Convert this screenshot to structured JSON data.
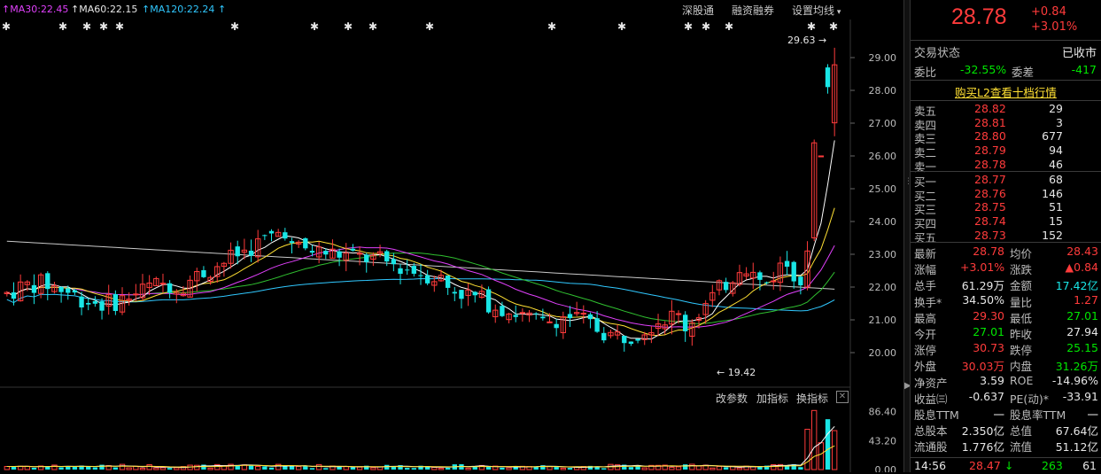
{
  "ma_legend": [
    {
      "label": "MA30:22.45",
      "color": "#e040fb"
    },
    {
      "label": "MA60:22.15",
      "color": "#e6e6e6"
    },
    {
      "label": "MA120:22.24",
      "color": "#30c8ff"
    }
  ],
  "toolbar": {
    "shen_gu_tong": "深股通",
    "rong_zi_rong_quan": "融资融券",
    "set_ma": "设置均线"
  },
  "vol_toolbar": {
    "change_params": "改参数",
    "add_indicator": "加指标",
    "swap_indicator": "换指标"
  },
  "annotations": {
    "high_label": "29.63",
    "low_label": "19.42"
  },
  "chart_data": {
    "type": "candlestick",
    "price_axis_ticks": [
      "29.00",
      "28.00",
      "27.00",
      "26.00",
      "25.00",
      "24.00",
      "23.00",
      "22.00",
      "21.00",
      "20.00"
    ],
    "volume_axis_ticks": [
      "86.40",
      "43.20",
      "0.00"
    ],
    "ylim": [
      19.0,
      30.0
    ],
    "volume_ylim": [
      0,
      95
    ],
    "last_candles": [
      {
        "open": 22.0,
        "close": 23.1,
        "high": 23.4,
        "low": 21.9
      },
      {
        "open": 23.5,
        "close": 26.4,
        "high": 26.5,
        "low": 23.4
      },
      {
        "open": 26.0,
        "close": 26.0,
        "high": 26.0,
        "low": 26.0
      },
      {
        "open": 28.7,
        "close": 28.1,
        "high": 28.8,
        "low": 27.9
      },
      {
        "open": 27.01,
        "close": 28.78,
        "high": 29.3,
        "low": 26.6
      }
    ]
  },
  "quote": {
    "price": "28.78",
    "change": "+0.84",
    "change_pct": "+3.01%",
    "status_label": "交易状态",
    "status_value": "已收市",
    "wei_bi_label": "委比",
    "wei_bi_value": "-32.55%",
    "wei_cha_label": "委差",
    "wei_cha_value": "-417",
    "buy_l2_link": "购买L2查看十档行情"
  },
  "order_book": {
    "asks": [
      {
        "label": "卖五",
        "price": "28.82",
        "vol": "29"
      },
      {
        "label": "卖四",
        "price": "28.81",
        "vol": "3"
      },
      {
        "label": "卖三",
        "price": "28.80",
        "vol": "677"
      },
      {
        "label": "卖二",
        "price": "28.79",
        "vol": "94"
      },
      {
        "label": "卖一",
        "price": "28.78",
        "vol": "46"
      }
    ],
    "bids": [
      {
        "label": "买一",
        "price": "28.77",
        "vol": "68"
      },
      {
        "label": "买二",
        "price": "28.76",
        "vol": "146"
      },
      {
        "label": "买三",
        "price": "28.75",
        "vol": "51"
      },
      {
        "label": "买四",
        "price": "28.74",
        "vol": "15"
      },
      {
        "label": "买五",
        "price": "28.73",
        "vol": "152"
      }
    ]
  },
  "stats": [
    {
      "l1": "最新",
      "v1": "28.78",
      "c1": "red",
      "l2": "均价",
      "v2": "28.43",
      "c2": "red"
    },
    {
      "l1": "涨幅",
      "v1": "+3.01%",
      "c1": "red",
      "l2": "涨跌",
      "v2": "▲0.84",
      "c2": "red"
    },
    {
      "l1": "总手",
      "v1": "61.29万",
      "c1": "white",
      "l2": "金额",
      "v2": "17.42亿",
      "c2": "cyan"
    },
    {
      "l1": "换手*",
      "v1": "34.50%",
      "c1": "white",
      "l2": "量比",
      "v2": "1.27",
      "c2": "red"
    },
    {
      "l1": "最高",
      "v1": "29.30",
      "c1": "red",
      "l2": "最低",
      "v2": "27.01",
      "c2": "green"
    },
    {
      "l1": "今开",
      "v1": "27.01",
      "c1": "green",
      "l2": "昨收",
      "v2": "27.94",
      "c2": "white"
    },
    {
      "l1": "涨停",
      "v1": "30.73",
      "c1": "red",
      "l2": "跌停",
      "v2": "25.15",
      "c2": "green"
    },
    {
      "l1": "外盘",
      "v1": "30.03万",
      "c1": "red",
      "l2": "内盘",
      "v2": "31.26万",
      "c2": "green"
    },
    {
      "l1": "净资产",
      "v1": "3.59",
      "c1": "white",
      "l2": "ROE",
      "v2": "-14.96%",
      "c2": "white"
    },
    {
      "l1": "收益㈢",
      "v1": "-0.637",
      "c1": "white",
      "l2": "PE(动)*",
      "v2": "-33.91",
      "c2": "white"
    },
    {
      "l1": "股息TTM",
      "v1": "一",
      "c1": "white",
      "l2": "股息率TTM",
      "v2": "一",
      "c2": "white"
    },
    {
      "l1": "总股本",
      "v1": "2.350亿",
      "c1": "white",
      "l2": "总值",
      "v2": "67.64亿",
      "c2": "white"
    },
    {
      "l1": "流通股",
      "v1": "1.776亿",
      "c1": "white",
      "l2": "流值",
      "v2": "51.12亿",
      "c2": "white"
    }
  ],
  "tick": {
    "time": "14:56",
    "price": "28.47",
    "vol": "263",
    "count": "61"
  },
  "colors": {
    "up": "#ff3b3b",
    "down": "#19e6e6",
    "ma5": "#ffffff",
    "ma10": "#ffe033",
    "ma30": "#e040fb",
    "ma60": "#30c030",
    "ma120": "#30c8ff",
    "ma250": "#c8c8c8"
  }
}
